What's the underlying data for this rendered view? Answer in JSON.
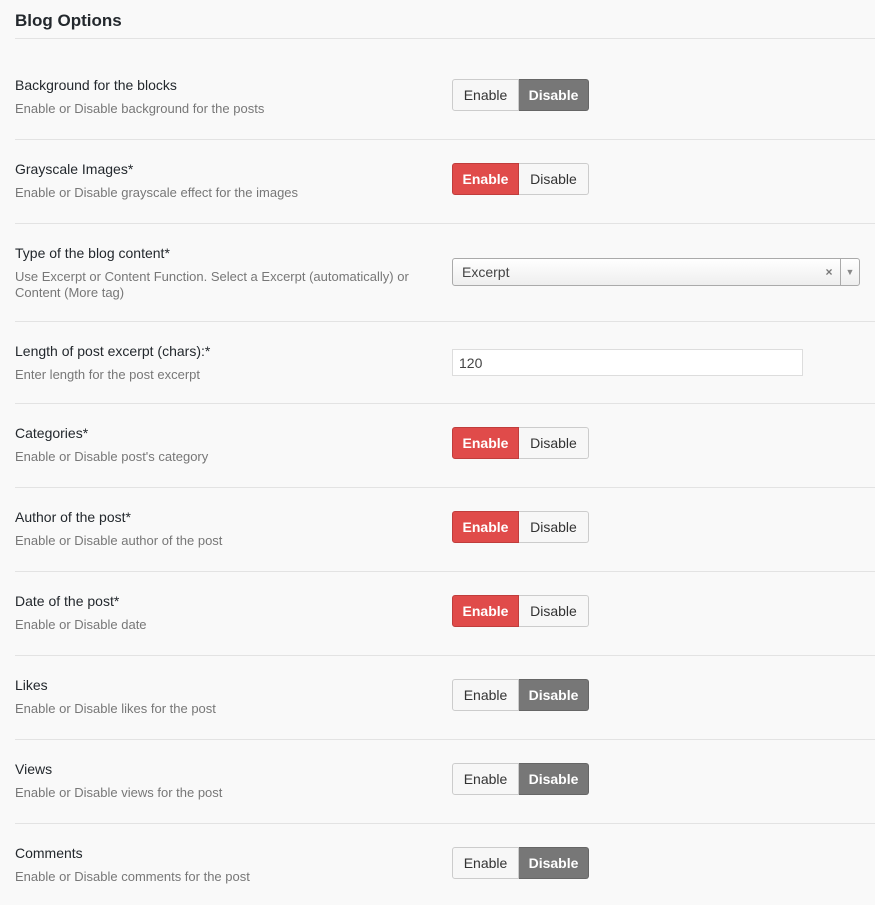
{
  "section": {
    "title": "Blog Options"
  },
  "colors": {
    "enabled_accent": "#e04b4a",
    "disabled_active": "#777777"
  },
  "options": [
    {
      "label": "Background for the blocks",
      "description": "Enable or Disable background for the posts",
      "active": "Disable"
    },
    {
      "label": "Grayscale Images*",
      "description": "Enable or Disable grayscale effect for the images",
      "active": "Enable"
    },
    {
      "label": "Type of the blog content*",
      "description": "Use Excerpt or Content Function. Select a Excerpt (automatically) or Content (More tag)",
      "select_value": "Excerpt",
      "clear_glyph": "×",
      "arrow_glyph": "▼"
    },
    {
      "label": "Length of post excerpt (chars):*",
      "description": "Enter length for the post excerpt",
      "input_value": "120"
    },
    {
      "label": "Categories*",
      "description": "Enable or Disable post's category",
      "active": "Enable"
    },
    {
      "label": "Author of the post*",
      "description": "Enable or Disable author of the post",
      "active": "Enable"
    },
    {
      "label": "Date of the post*",
      "description": "Enable or Disable date",
      "active": "Enable"
    },
    {
      "label": "Likes",
      "description": "Enable or Disable likes for the post",
      "active": "Disable"
    },
    {
      "label": "Views",
      "description": "Enable or Disable views for the post",
      "active": "Disable"
    },
    {
      "label": "Comments",
      "description": "Enable or Disable comments for the post",
      "active": "Disable"
    }
  ],
  "buttons": {
    "enable_label": "Enable",
    "disable_label": "Disable"
  }
}
